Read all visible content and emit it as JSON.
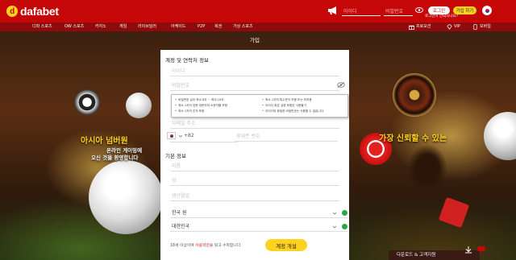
{
  "header": {
    "brand": "dafabet",
    "username_placeholder": "아이디",
    "password_placeholder": "비밀번호",
    "forgot_label": "로그인이 안되시나요?",
    "login_label": "로그인",
    "join_label": "가입 하기",
    "accent": "#c50707",
    "join_color": "#ffd21f"
  },
  "nav": {
    "items": [
      "디파 스포츠",
      "OW 스포츠",
      "카지노",
      "게임",
      "라이브딜러",
      "아케이드",
      "P2P",
      "복권",
      "가상 스포츠"
    ],
    "right": [
      "프로모션",
      "VIP",
      "모바일"
    ]
  },
  "promo": {
    "left_title": "아시아 넘버원",
    "left_line1": "온라인 게이밍에",
    "left_line2": "오신 것을 환영합니다",
    "right_title": "가장 신뢰할 수 있는"
  },
  "form": {
    "tab_label": "가입",
    "section1_title": "계정 및 연락처 정보",
    "username_placeholder": "아이디",
    "password_placeholder": "비밀번호",
    "tips": [
      "비밀번호 길이 최소 6자 ~ 최대 16자",
      "최소 1자의 영문 대문자와 소문자를 포함",
      "최소 1자의 숫자 포함",
      "최소 1자의 특수문자 허용 또는 미허용",
      "아이디 혹은 실명 포함은 사용불가",
      "아이디와 동일한 비밀번호는 사용할 수 없습니다."
    ],
    "email_placeholder": "이메일 주소",
    "phone_code": "+82",
    "phone_placeholder": "휴대폰 번호",
    "section2_title": "기본 정보",
    "first_name_placeholder": "이름",
    "last_name_placeholder": "성",
    "dob_placeholder": "생년월일",
    "currency_value": "한국 원",
    "country_value": "대한민국",
    "terms_prefix": "18세 이상이며 ",
    "terms_link": "이용약관",
    "terms_suffix": "을 읽고 수락합니다.",
    "submit_label": "계정 개설"
  },
  "download_bar": "다운로드 & 고객지원"
}
